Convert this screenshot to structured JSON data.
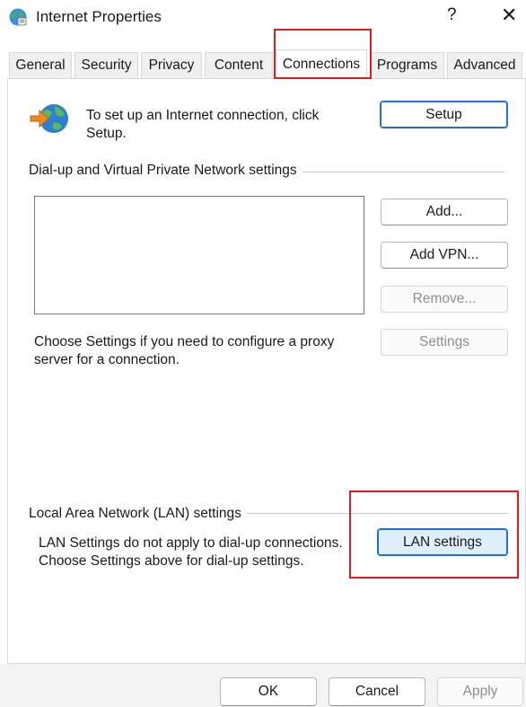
{
  "window": {
    "title": "Internet Properties",
    "help_label": "?",
    "close_label": "✕",
    "icon": "internet-options-globe-icon"
  },
  "tabs": [
    {
      "label": "General"
    },
    {
      "label": "Security"
    },
    {
      "label": "Privacy"
    },
    {
      "label": "Content"
    },
    {
      "label": "Connections",
      "active": true
    },
    {
      "label": "Programs"
    },
    {
      "label": "Advanced"
    }
  ],
  "setup": {
    "text": "To set up an Internet connection, click Setup.",
    "button_label": "Setup",
    "icon": "globe-arrow-icon"
  },
  "dialup": {
    "group_label": "Dial-up and Virtual Private Network settings",
    "connections": [],
    "add_label": "Add...",
    "add_vpn_label": "Add VPN...",
    "remove_label": "Remove...",
    "settings_text": "Choose Settings if you need to configure a proxy server for a connection.",
    "settings_label": "Settings"
  },
  "lan": {
    "group_label": "Local Area Network (LAN) settings",
    "description": "LAN Settings do not apply to dial-up connections. Choose Settings above for dial-up settings.",
    "button_label": "LAN settings"
  },
  "footer": {
    "ok_label": "OK",
    "cancel_label": "Cancel",
    "apply_label": "Apply"
  },
  "colors": {
    "highlight": "#e11d1d",
    "accent": "#1f6fd6"
  }
}
